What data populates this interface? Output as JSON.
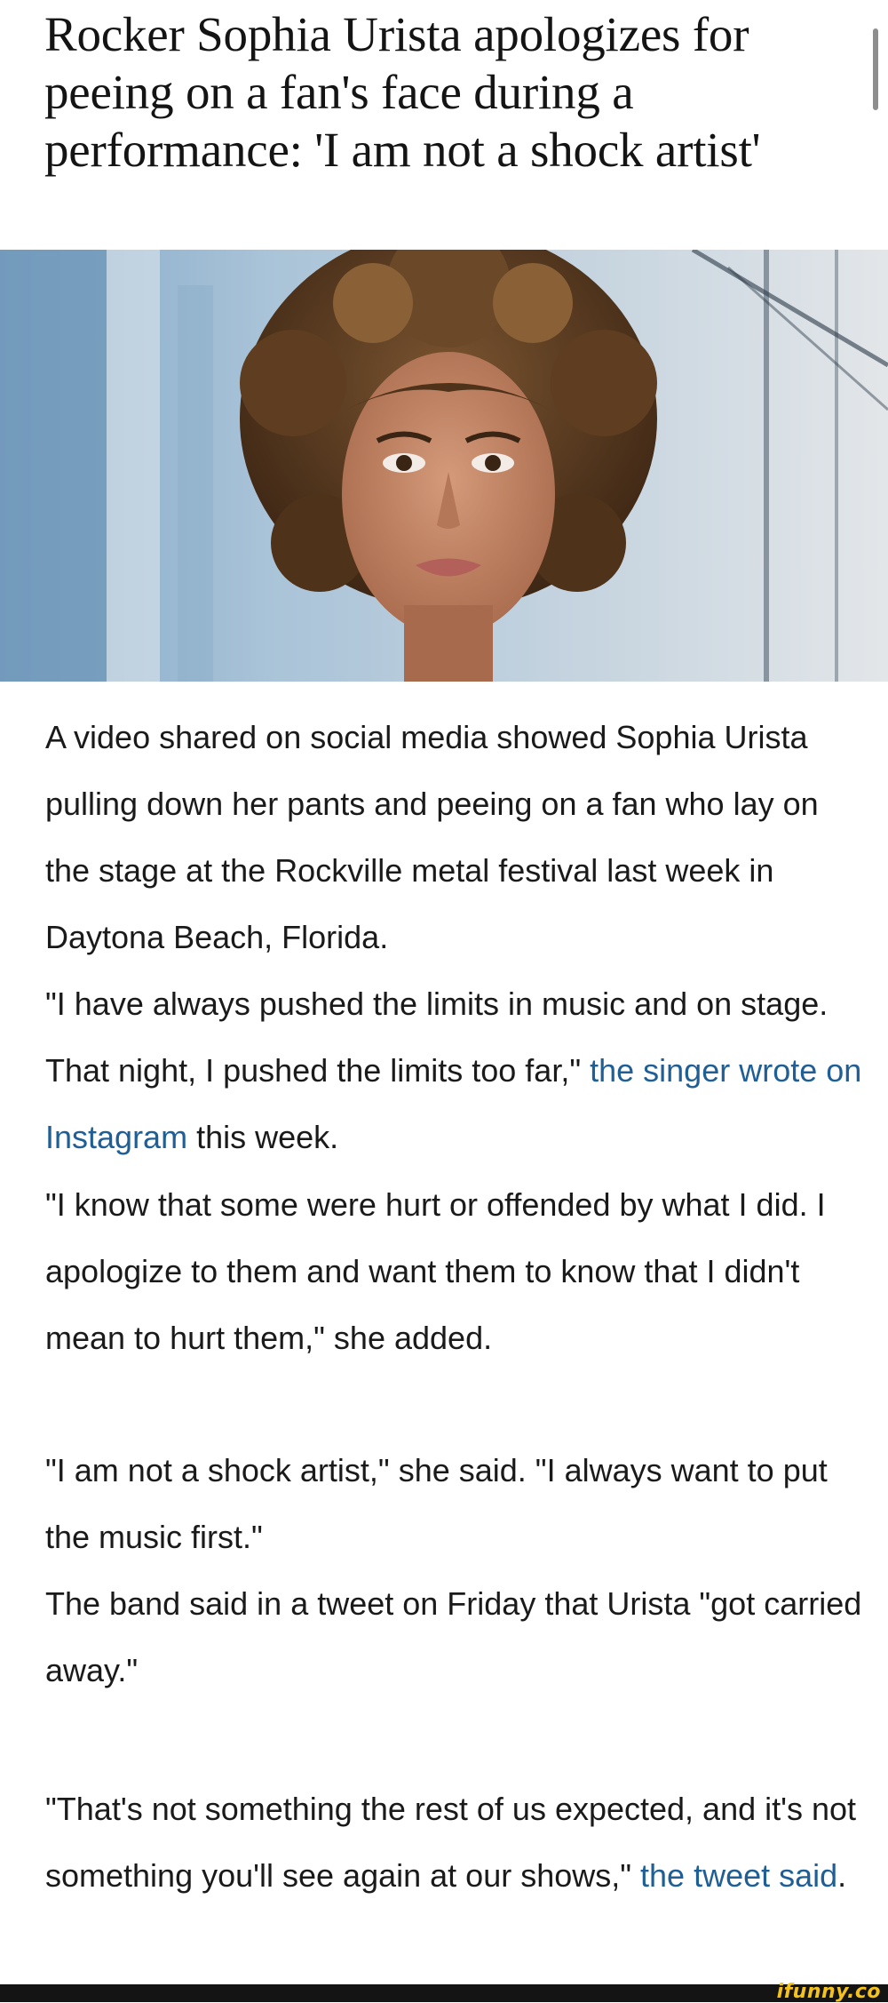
{
  "headline": "Rocker Sophia Urista apologizes for peeing on a fan's face during a performance: 'I am not a shock artist'",
  "photo": {
    "icon": "portrait-photo"
  },
  "paragraphs": [
    {
      "text": "A video shared on social media showed Sophia Urista pulling down her pants and peeing on a fan who lay on the stage at the Rockville metal festival last week in Daytona Beach, Florida."
    },
    {
      "before": "\"I have always pushed the limits in music and on stage. That night, I pushed the limits too far,\" ",
      "link": "the singer wrote on Instagram",
      "after": " this week."
    },
    {
      "text": "\"I know that some were hurt or offended by what I did. I apologize to them and want them to know that I didn't mean to hurt them,\" she added."
    },
    {
      "line1": "\"I am not a shock artist,\" she said. \"I always want to put the music first.\"",
      "line2": "The band said in a tweet on Friday that Urista \"got carried away.\""
    },
    {
      "before": "\"That's not something the rest of us expected, and it's not something you'll see again at our shows,\" ",
      "link": "the tweet said",
      "after": "."
    }
  ],
  "watermark": "ifunny.co",
  "colors": {
    "link": "#1f5f96",
    "text": "#1a1a1a",
    "watermark": "#f4c21a"
  }
}
